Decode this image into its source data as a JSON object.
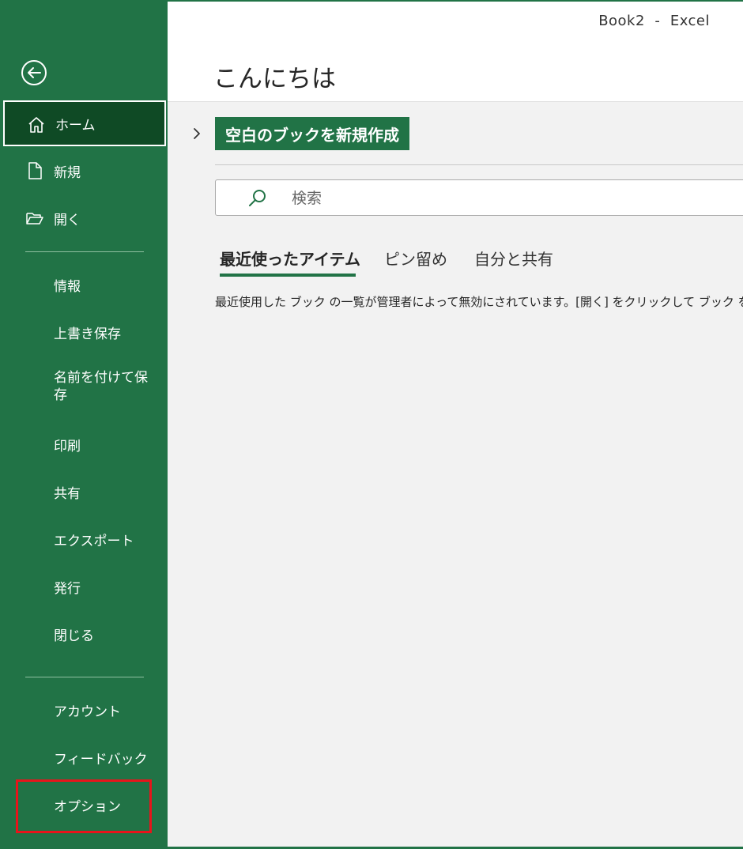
{
  "window": {
    "title": "Book2  -  Excel"
  },
  "sidebar": {
    "back_label": "",
    "items": [
      {
        "label": "ホーム",
        "icon": "home-icon"
      },
      {
        "label": "新規",
        "icon": "new-file-icon"
      },
      {
        "label": "開く",
        "icon": "open-folder-icon"
      },
      {
        "label": "情報"
      },
      {
        "label": "上書き保存"
      },
      {
        "label": "名前を付けて保存"
      },
      {
        "label": "印刷"
      },
      {
        "label": "共有"
      },
      {
        "label": "エクスポート"
      },
      {
        "label": "発行"
      },
      {
        "label": "閉じる"
      },
      {
        "label": "アカウント"
      },
      {
        "label": "フィードバック"
      },
      {
        "label": "オプション"
      }
    ]
  },
  "main": {
    "greeting": "こんにちは",
    "new_blank_label": "空白のブックを新規作成",
    "search": {
      "placeholder": "検索",
      "value": ""
    },
    "tabs": [
      {
        "label": "最近使ったアイテム"
      },
      {
        "label": "ピン留め"
      },
      {
        "label": "自分と共有"
      }
    ],
    "notice": "最近使用した ブック の一覧が管理者によって無効にされています。[開く] をクリックして ブック を参照してください。"
  },
  "colors": {
    "sidebar_bg": "#217346",
    "active_item_bg": "#0f4a25",
    "highlight_border": "#e8141b",
    "main_bg": "#f2f2f2"
  }
}
